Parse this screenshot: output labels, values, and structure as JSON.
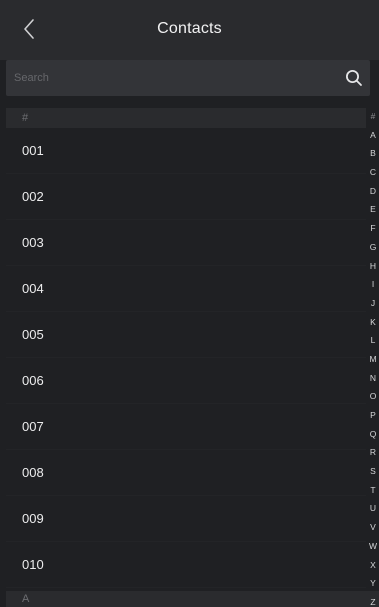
{
  "header": {
    "title": "Contacts",
    "back_icon": "chevron-left-icon"
  },
  "search": {
    "placeholder": "Search",
    "icon": "search-icon"
  },
  "sections": [
    {
      "letter": "#",
      "contacts": [
        "001",
        "002",
        "003",
        "004",
        "005",
        "006",
        "007",
        "008",
        "009",
        "010"
      ]
    },
    {
      "letter": "A",
      "contacts": []
    }
  ],
  "alphabet_index": [
    "#",
    "A",
    "B",
    "C",
    "D",
    "E",
    "F",
    "G",
    "H",
    "I",
    "J",
    "K",
    "L",
    "M",
    "N",
    "O",
    "P",
    "Q",
    "R",
    "S",
    "T",
    "U",
    "V",
    "W",
    "X",
    "Y",
    "Z"
  ],
  "colors": {
    "background": "#1f2023",
    "header": "#2a2b2e",
    "search_bg": "#333438",
    "text": "#ececed",
    "muted": "#6d6e72"
  }
}
